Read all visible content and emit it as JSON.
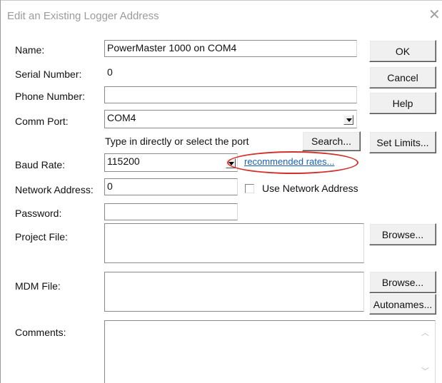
{
  "dialog": {
    "title": "Edit an Existing Logger Address",
    "close_glyph": "✕"
  },
  "labels": {
    "name": "Name:",
    "serial_number": "Serial Number:",
    "phone_number": "Phone Number:",
    "comm_port": "Comm Port:",
    "baud_rate": "Baud Rate:",
    "network_address": "Network Address:",
    "password": "Password:",
    "project_file": "Project File:",
    "mdm_file": "MDM File:",
    "comments": "Comments:"
  },
  "fields": {
    "name_value": "PowerMaster 1000 on COM4",
    "serial_number_value": "0",
    "phone_number_value": "",
    "comm_port_value": "COM4",
    "comm_port_hint": "Type in directly or select the port",
    "baud_rate_value": "115200",
    "network_address_value": "0",
    "password_value": "",
    "project_file_value": "",
    "mdm_file_value": "",
    "comments_value": ""
  },
  "buttons": {
    "ok": "OK",
    "cancel": "Cancel",
    "help": "Help",
    "search": "Search...",
    "set_limits": "Set Limits...",
    "browse_project": "Browse...",
    "browse_mdm": "Browse...",
    "autonames": "Autonames..."
  },
  "links": {
    "recommended_rates": "recommended rates..."
  },
  "checkboxes": {
    "use_network_address": {
      "label": "Use Network Address",
      "checked": false
    }
  },
  "icons": {
    "close": "close-icon",
    "dropdown": "chevron-down-icon",
    "scroll_up": "scroll-up-icon",
    "scroll_down": "scroll-down-icon"
  },
  "colors": {
    "annotation_ellipse": "#d2302a",
    "link": "#1a5fb4"
  }
}
